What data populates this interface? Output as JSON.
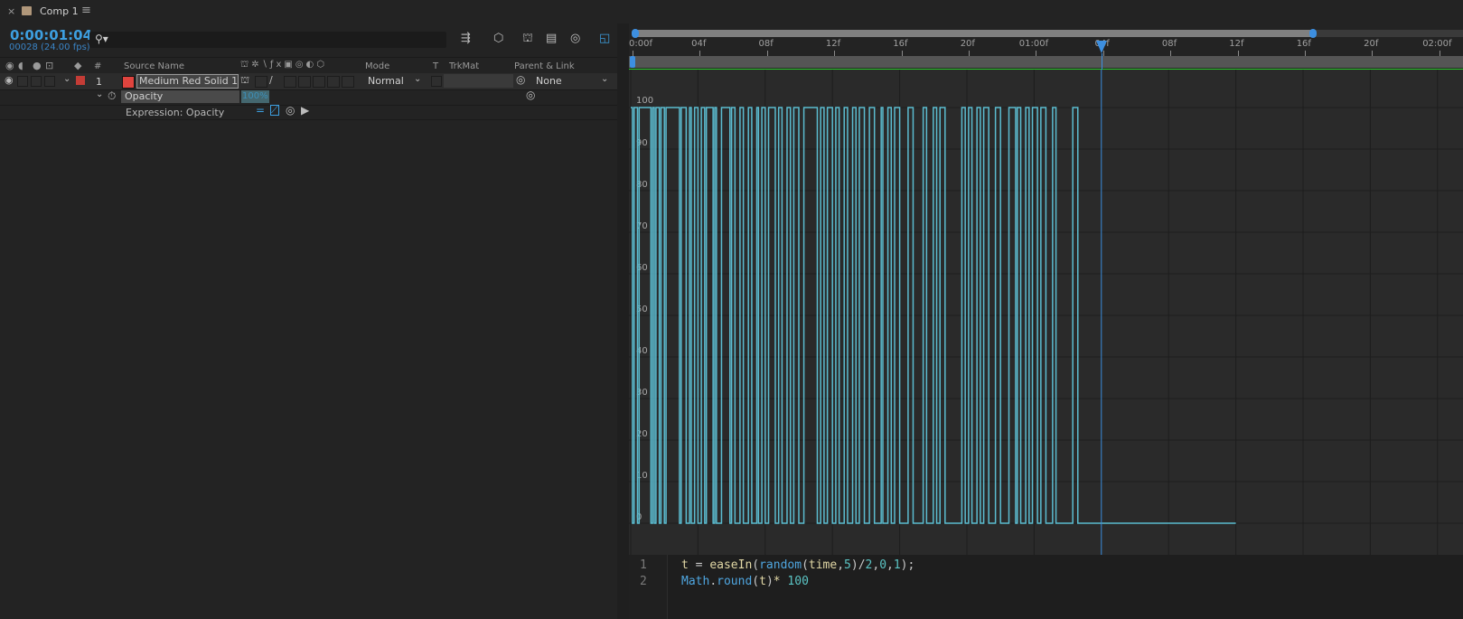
{
  "tab": {
    "title": "Comp 1",
    "menu_icon": "hamburger-icon",
    "close_icon": "close-icon"
  },
  "timecode": {
    "time": "0:00:01:04",
    "frames": "00028 (24.00 fps)"
  },
  "search": {
    "placeholder": ""
  },
  "columns": {
    "num": "#",
    "source_name": "Source Name",
    "mode": "Mode",
    "t": "T",
    "trkmat": "TrkMat",
    "parent_link": "Parent & Link"
  },
  "layer": {
    "index": "1",
    "name": "Medium Red Solid 1",
    "mode": "Normal",
    "parent": "None",
    "label_color": "#e0443e"
  },
  "property": {
    "name": "Opacity",
    "value": "100%"
  },
  "expression": {
    "label": "Expression: Opacity"
  },
  "ruler": {
    "ticks": [
      "0:00f",
      "04f",
      "08f",
      "12f",
      "16f",
      "20f",
      "01:00f",
      "04f",
      "08f",
      "12f",
      "16f",
      "20f",
      "02:00f"
    ]
  },
  "graph": {
    "y_labels": [
      "100",
      "90",
      "80",
      "70",
      "60",
      "50",
      "40",
      "30",
      "20",
      "10",
      "0"
    ],
    "accent": "#5bbcd0",
    "playhead_color": "#3d8fe0"
  },
  "chart_data": {
    "type": "line",
    "xlim_frames": [
      0,
      36
    ],
    "ylim": [
      0,
      100
    ],
    "playhead_frame": 28,
    "series": [
      {
        "steps": [
          [
            0,
            100
          ],
          [
            0.1,
            0
          ],
          [
            0.2,
            100
          ],
          [
            0.4,
            0
          ],
          [
            0.5,
            100
          ],
          [
            1.2,
            0
          ],
          [
            1.3,
            100
          ],
          [
            1.4,
            0
          ],
          [
            1.5,
            100
          ],
          [
            1.7,
            0
          ],
          [
            1.8,
            100
          ],
          [
            2.0,
            0
          ],
          [
            2.1,
            100
          ],
          [
            2.9,
            0
          ],
          [
            3.0,
            100
          ],
          [
            3.3,
            0
          ],
          [
            3.5,
            100
          ],
          [
            3.6,
            0
          ],
          [
            3.8,
            100
          ],
          [
            4.0,
            0
          ],
          [
            4.2,
            100
          ],
          [
            4.4,
            0
          ],
          [
            4.5,
            100
          ],
          [
            4.9,
            0
          ],
          [
            5.0,
            100
          ],
          [
            5.1,
            0
          ],
          [
            5.4,
            100
          ],
          [
            5.9,
            0
          ],
          [
            6.0,
            100
          ],
          [
            6.2,
            0
          ],
          [
            6.5,
            100
          ],
          [
            6.7,
            0
          ],
          [
            7.0,
            100
          ],
          [
            7.2,
            0
          ],
          [
            7.5,
            100
          ],
          [
            7.6,
            0
          ],
          [
            7.8,
            100
          ],
          [
            8.0,
            0
          ],
          [
            8.2,
            100
          ],
          [
            8.6,
            0
          ],
          [
            8.8,
            100
          ],
          [
            9.0,
            0
          ],
          [
            9.3,
            100
          ],
          [
            9.5,
            0
          ],
          [
            9.7,
            100
          ],
          [
            10.0,
            0
          ],
          [
            10.3,
            100
          ],
          [
            11.1,
            0
          ],
          [
            11.3,
            100
          ],
          [
            11.5,
            0
          ],
          [
            11.7,
            100
          ],
          [
            12.0,
            0
          ],
          [
            12.2,
            100
          ],
          [
            12.4,
            0
          ],
          [
            12.7,
            100
          ],
          [
            12.9,
            0
          ],
          [
            13.2,
            100
          ],
          [
            13.4,
            0
          ],
          [
            13.6,
            100
          ],
          [
            13.9,
            0
          ],
          [
            14.2,
            100
          ],
          [
            14.5,
            0
          ],
          [
            14.9,
            100
          ],
          [
            15.0,
            0
          ],
          [
            15.3,
            100
          ],
          [
            15.5,
            0
          ],
          [
            15.7,
            100
          ],
          [
            16.0,
            0
          ],
          [
            16.5,
            100
          ],
          [
            16.8,
            0
          ],
          [
            17.4,
            100
          ],
          [
            17.6,
            0
          ],
          [
            18.0,
            100
          ],
          [
            18.2,
            0
          ],
          [
            18.4,
            100
          ],
          [
            18.7,
            0
          ],
          [
            19.7,
            100
          ],
          [
            19.9,
            0
          ],
          [
            20.1,
            100
          ],
          [
            20.3,
            0
          ],
          [
            20.6,
            100
          ],
          [
            20.8,
            0
          ],
          [
            21.0,
            100
          ],
          [
            21.3,
            0
          ],
          [
            21.7,
            100
          ],
          [
            22.0,
            0
          ],
          [
            22.5,
            100
          ],
          [
            22.9,
            0
          ],
          [
            23.0,
            100
          ],
          [
            23.2,
            0
          ],
          [
            23.5,
            100
          ],
          [
            23.7,
            0
          ],
          [
            23.9,
            100
          ],
          [
            24.2,
            0
          ],
          [
            24.4,
            100
          ],
          [
            24.7,
            0
          ],
          [
            25.1,
            100
          ],
          [
            25.3,
            0
          ],
          [
            26.3,
            100
          ],
          [
            26.6,
            0
          ],
          [
            36,
            0
          ]
        ]
      }
    ]
  },
  "code": {
    "line_numbers": [
      "1",
      "2"
    ],
    "line1": [
      {
        "t": "t",
        "c": "#e2d8a6"
      },
      {
        "t": " = ",
        "c": "#c8c8c8"
      },
      {
        "t": "easeIn",
        "c": "#e2d8a6"
      },
      {
        "t": "(",
        "c": "#c8c8c8"
      },
      {
        "t": "random",
        "c": "#4fa6e0"
      },
      {
        "t": "(",
        "c": "#c8c8c8"
      },
      {
        "t": "time",
        "c": "#e2d8a6"
      },
      {
        "t": ",",
        "c": "#c8c8c8"
      },
      {
        "t": "5",
        "c": "#5bc4c4"
      },
      {
        "t": ")/",
        "c": "#c8c8c8"
      },
      {
        "t": "2",
        "c": "#5bc4c4"
      },
      {
        "t": ",",
        "c": "#c8c8c8"
      },
      {
        "t": "0",
        "c": "#5bc4c4"
      },
      {
        "t": ",",
        "c": "#c8c8c8"
      },
      {
        "t": "1",
        "c": "#5bc4c4"
      },
      {
        "t": ");",
        "c": "#c8c8c8"
      }
    ],
    "line2": [
      {
        "t": "Math",
        "c": "#4fa6e0"
      },
      {
        "t": ".",
        "c": "#c8c8c8"
      },
      {
        "t": "round",
        "c": "#4fa6e0"
      },
      {
        "t": "(",
        "c": "#c8c8c8"
      },
      {
        "t": "t",
        "c": "#e2d8a6"
      },
      {
        "t": ")",
        "c": "#c8c8c8"
      },
      {
        "t": "* ",
        "c": "#e2d8a6"
      },
      {
        "t": "100",
        "c": "#5bc4c4"
      }
    ]
  }
}
